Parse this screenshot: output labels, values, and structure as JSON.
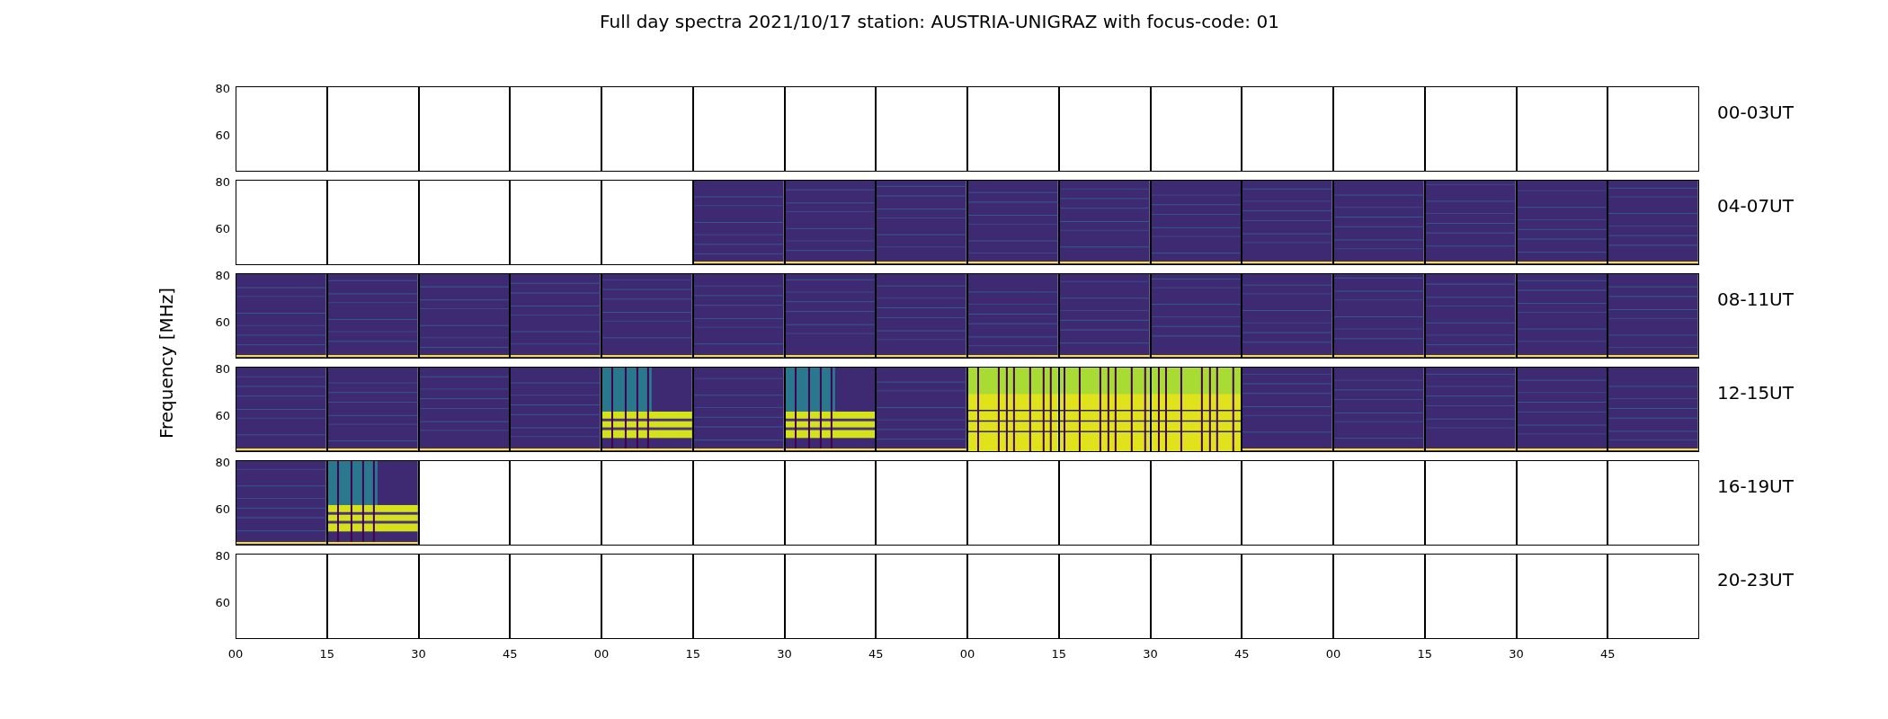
{
  "title": "Full day spectra 2021/10/17 station: AUSTRIA-UNIGRAZ with focus-code: 01",
  "ylabel": "Frequency [MHz]",
  "rows": [
    {
      "label": "00-03UT",
      "yticks": [
        "80",
        "60"
      ],
      "panels": [
        {
          "kind": "blank"
        },
        {
          "kind": "blank"
        },
        {
          "kind": "blank"
        },
        {
          "kind": "blank"
        },
        {
          "kind": "blank"
        },
        {
          "kind": "blank"
        },
        {
          "kind": "blank"
        },
        {
          "kind": "blank"
        },
        {
          "kind": "blank"
        },
        {
          "kind": "blank"
        },
        {
          "kind": "blank"
        },
        {
          "kind": "blank"
        },
        {
          "kind": "blank"
        },
        {
          "kind": "blank"
        },
        {
          "kind": "blank"
        },
        {
          "kind": "blank"
        }
      ]
    },
    {
      "label": "04-07UT",
      "yticks": [
        "80",
        "60"
      ],
      "panels": [
        {
          "kind": "blank"
        },
        {
          "kind": "blank"
        },
        {
          "kind": "blank"
        },
        {
          "kind": "blank"
        },
        {
          "kind": "blank"
        },
        {
          "kind": "quiet"
        },
        {
          "kind": "quiet"
        },
        {
          "kind": "quiet"
        },
        {
          "kind": "quiet"
        },
        {
          "kind": "quiet"
        },
        {
          "kind": "quiet"
        },
        {
          "kind": "quiet"
        },
        {
          "kind": "quiet"
        },
        {
          "kind": "quiet"
        },
        {
          "kind": "quiet"
        },
        {
          "kind": "quiet"
        }
      ]
    },
    {
      "label": "08-11UT",
      "yticks": [
        "80",
        "60"
      ],
      "panels": [
        {
          "kind": "quiet"
        },
        {
          "kind": "quiet"
        },
        {
          "kind": "quiet"
        },
        {
          "kind": "quiet"
        },
        {
          "kind": "quiet"
        },
        {
          "kind": "quiet"
        },
        {
          "kind": "quiet"
        },
        {
          "kind": "quiet"
        },
        {
          "kind": "quiet"
        },
        {
          "kind": "quiet"
        },
        {
          "kind": "quiet"
        },
        {
          "kind": "quiet"
        },
        {
          "kind": "quiet"
        },
        {
          "kind": "quiet"
        },
        {
          "kind": "quiet"
        },
        {
          "kind": "quiet"
        }
      ]
    },
    {
      "label": "12-15UT",
      "yticks": [
        "80",
        "60"
      ],
      "panels": [
        {
          "kind": "quiet"
        },
        {
          "kind": "quiet"
        },
        {
          "kind": "quiet"
        },
        {
          "kind": "quiet"
        },
        {
          "kind": "band"
        },
        {
          "kind": "quiet"
        },
        {
          "kind": "band"
        },
        {
          "kind": "quiet"
        },
        {
          "kind": "flare"
        },
        {
          "kind": "flare"
        },
        {
          "kind": "flare"
        },
        {
          "kind": "quiet"
        },
        {
          "kind": "quiet"
        },
        {
          "kind": "quiet"
        },
        {
          "kind": "quiet"
        },
        {
          "kind": "quiet"
        }
      ]
    },
    {
      "label": "16-19UT",
      "yticks": [
        "80",
        "60"
      ],
      "panels": [
        {
          "kind": "quiet"
        },
        {
          "kind": "band"
        },
        {
          "kind": "blank"
        },
        {
          "kind": "blank"
        },
        {
          "kind": "blank"
        },
        {
          "kind": "blank"
        },
        {
          "kind": "blank"
        },
        {
          "kind": "blank"
        },
        {
          "kind": "blank"
        },
        {
          "kind": "blank"
        },
        {
          "kind": "blank"
        },
        {
          "kind": "blank"
        },
        {
          "kind": "blank"
        },
        {
          "kind": "blank"
        },
        {
          "kind": "blank"
        },
        {
          "kind": "blank"
        }
      ]
    },
    {
      "label": "20-23UT",
      "yticks": [
        "80",
        "60"
      ],
      "panels": [
        {
          "kind": "blank"
        },
        {
          "kind": "blank"
        },
        {
          "kind": "blank"
        },
        {
          "kind": "blank"
        },
        {
          "kind": "blank"
        },
        {
          "kind": "blank"
        },
        {
          "kind": "blank"
        },
        {
          "kind": "blank"
        },
        {
          "kind": "blank"
        },
        {
          "kind": "blank"
        },
        {
          "kind": "blank"
        },
        {
          "kind": "blank"
        },
        {
          "kind": "blank"
        },
        {
          "kind": "blank"
        },
        {
          "kind": "blank"
        },
        {
          "kind": "blank"
        }
      ]
    }
  ],
  "xticks": [
    "00",
    "15",
    "30",
    "45",
    "00",
    "15",
    "30",
    "45",
    "00",
    "15",
    "30",
    "45",
    "00",
    "15",
    "30",
    "45"
  ]
}
